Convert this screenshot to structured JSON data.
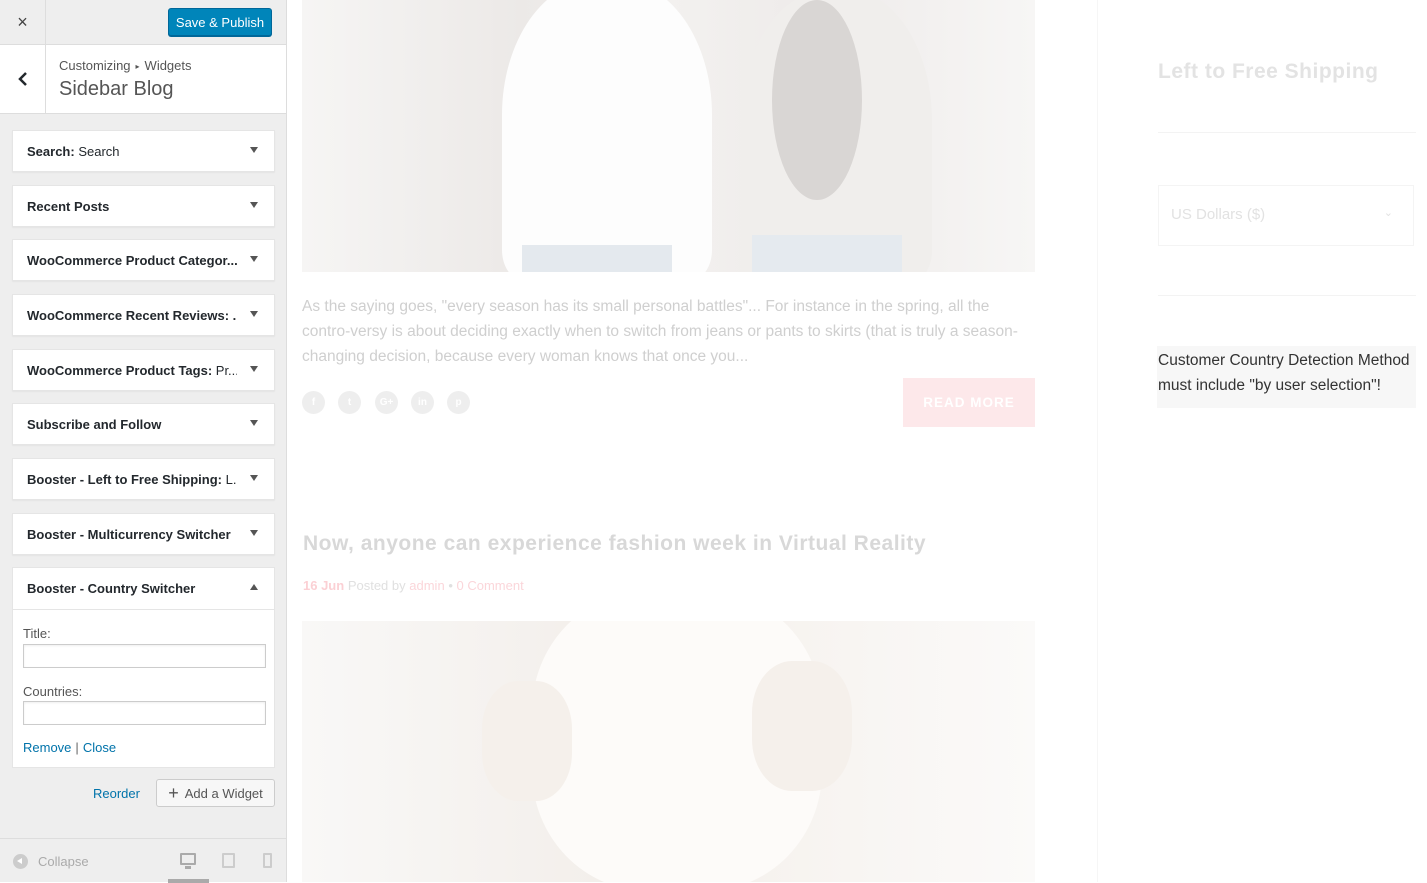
{
  "header": {
    "close_icon": "×",
    "save_label": "Save & Publish"
  },
  "breadcrumb": {
    "parent": "Customizing",
    "separator": "▸",
    "current": "Widgets"
  },
  "panel_title": "Sidebar Blog",
  "widgets": [
    {
      "name_bold": "Search:",
      "name_rest": " Search"
    },
    {
      "name_bold": "Recent Posts",
      "name_rest": ""
    },
    {
      "name_bold": "WooCommerce Product Categor...",
      "name_rest": ""
    },
    {
      "name_bold": "WooCommerce Recent Reviews: ...",
      "name_rest": ""
    },
    {
      "name_bold": "WooCommerce Product Tags:",
      "name_rest": " Pr..."
    },
    {
      "name_bold": "Subscribe and Follow",
      "name_rest": ""
    },
    {
      "name_bold": "Booster - Left to Free Shipping:",
      "name_rest": " L..."
    },
    {
      "name_bold": "Booster - Multicurrency Switcher",
      "name_rest": ""
    }
  ],
  "open_widget": {
    "title": "Booster - Country Switcher",
    "title_label": "Title:",
    "title_value": "",
    "countries_label": "Countries:",
    "countries_value": "",
    "remove_label": "Remove",
    "pipe": "|",
    "close_label": "Close"
  },
  "footer_actions": {
    "reorder_label": "Reorder",
    "add_widget_label": "Add a Widget",
    "plus": "+"
  },
  "sb_footer": {
    "collapse_label": "Collapse"
  },
  "preview": {
    "excerpt": "As the saying goes, \"every season has its small personal battles\"... For instance in the spring, all the contro-versy is about deciding exactly when to switch from jeans or pants to skirts (that is truly a season-changing decision, because every woman knows that once you...",
    "social": [
      "f",
      "t",
      "G+",
      "in",
      "p"
    ],
    "read_more": "READ MORE",
    "post_title": "Now, anyone can experience fashion week in Virtual Reality",
    "post_date": "16 Jun",
    "posted_by": "Posted by",
    "author": "admin",
    "bullet": "•",
    "comments": "0 Comment",
    "shipping_title": "Left to Free Shipping",
    "currency_value": "US Dollars ($)",
    "currency_chevron": "⌄",
    "notice": "Customer Country Detection Method must include \"by user selection\"!"
  },
  "colors": {
    "primary_button": "#0085ba",
    "link": "#0073aa",
    "accent_pink": "#fde8ea"
  }
}
